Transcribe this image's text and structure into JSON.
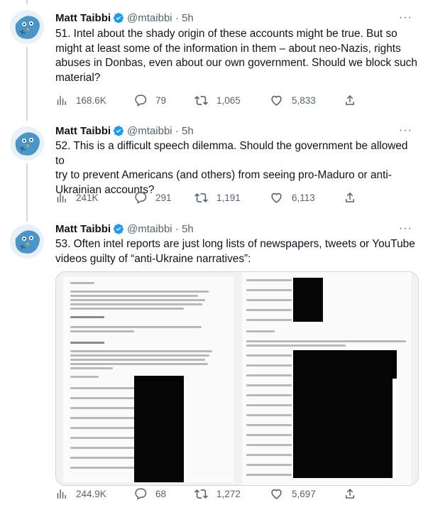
{
  "tweets": [
    {
      "name": "Matt Taibbi",
      "handle": "@mtaibbi",
      "separator": "·",
      "time": "5h",
      "lines": [
        "51. Intel about the shady origin of these accounts might be true. But so",
        "might at least some of the information in them – about neo-Nazis,  rights",
        "abuses in Donbas, even about our own government. Should we block such",
        "material?"
      ],
      "stats": {
        "views": "168.6K",
        "replies": "79",
        "retweets": "1,065",
        "likes": "5,833"
      }
    },
    {
      "name": "Matt Taibbi",
      "handle": "@mtaibbi",
      "separator": "·",
      "time": "5h",
      "lines": [
        "52. This is a difficult speech dilemma. Should the government be allowed to",
        "try to prevent Americans (and others) from seeing pro-Maduro or anti-",
        "Ukrainian accounts?"
      ],
      "stats": {
        "views": "241K",
        "replies": "291",
        "retweets": "1,191",
        "likes": "6,113"
      }
    },
    {
      "name": "Matt Taibbi",
      "handle": "@mtaibbi",
      "separator": "·",
      "time": "5h",
      "lines": [
        "53. Often intel reports are just long lists of newspapers, tweets or YouTube",
        "videos guilty of “anti-Ukraine narratives”:"
      ],
      "stats": {
        "views": "244.9K",
        "replies": "68",
        "retweets": "1,272",
        "likes": "5,697"
      }
    }
  ],
  "icons": {
    "verified": "verified-badge-icon",
    "more": "more-options-icon",
    "views": "analytics-icon",
    "reply": "reply-icon",
    "retweet": "retweet-icon",
    "like": "heart-icon",
    "share": "share-icon"
  },
  "colors": {
    "verified": "#1d9bf0",
    "muted": "#536471",
    "text": "#0f1419",
    "border": "#cfd9de"
  },
  "more_glyph": "···"
}
